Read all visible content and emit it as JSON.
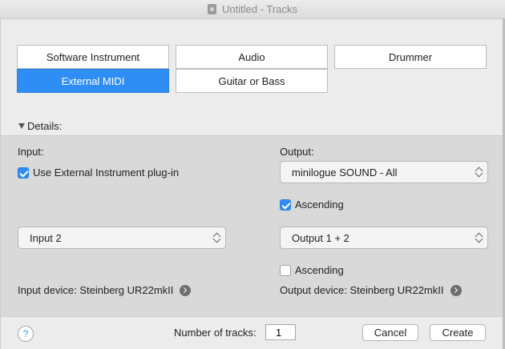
{
  "window": {
    "title": "Untitled - Tracks"
  },
  "track_types": [
    {
      "label": "Software Instrument",
      "selected": false
    },
    {
      "label": "Audio",
      "selected": false
    },
    {
      "label": "Drummer",
      "selected": false
    },
    {
      "label": "External MIDI",
      "selected": true
    },
    {
      "label": "Guitar or Bass",
      "selected": false
    }
  ],
  "details": {
    "toggle_label": "Details:",
    "input": {
      "label": "Input:",
      "use_plugin_label": "Use External Instrument plug-in",
      "use_plugin_checked": true,
      "popup_value": "Input 2",
      "device_label": "Input device: Steinberg UR22mkII"
    },
    "output": {
      "label": "Output:",
      "midi_popup_value": "minilogue SOUND - All",
      "ascending_1_label": "Ascending",
      "ascending_1_checked": true,
      "audio_popup_value": "Output 1 + 2",
      "ascending_2_label": "Ascending",
      "ascending_2_checked": false,
      "device_label": "Output device: Steinberg UR22mkII"
    }
  },
  "footer": {
    "help_label": "?",
    "num_tracks_label": "Number of tracks:",
    "num_tracks_value": "1",
    "cancel_label": "Cancel",
    "create_label": "Create"
  },
  "colors": {
    "accent": "#2f8ef5"
  }
}
